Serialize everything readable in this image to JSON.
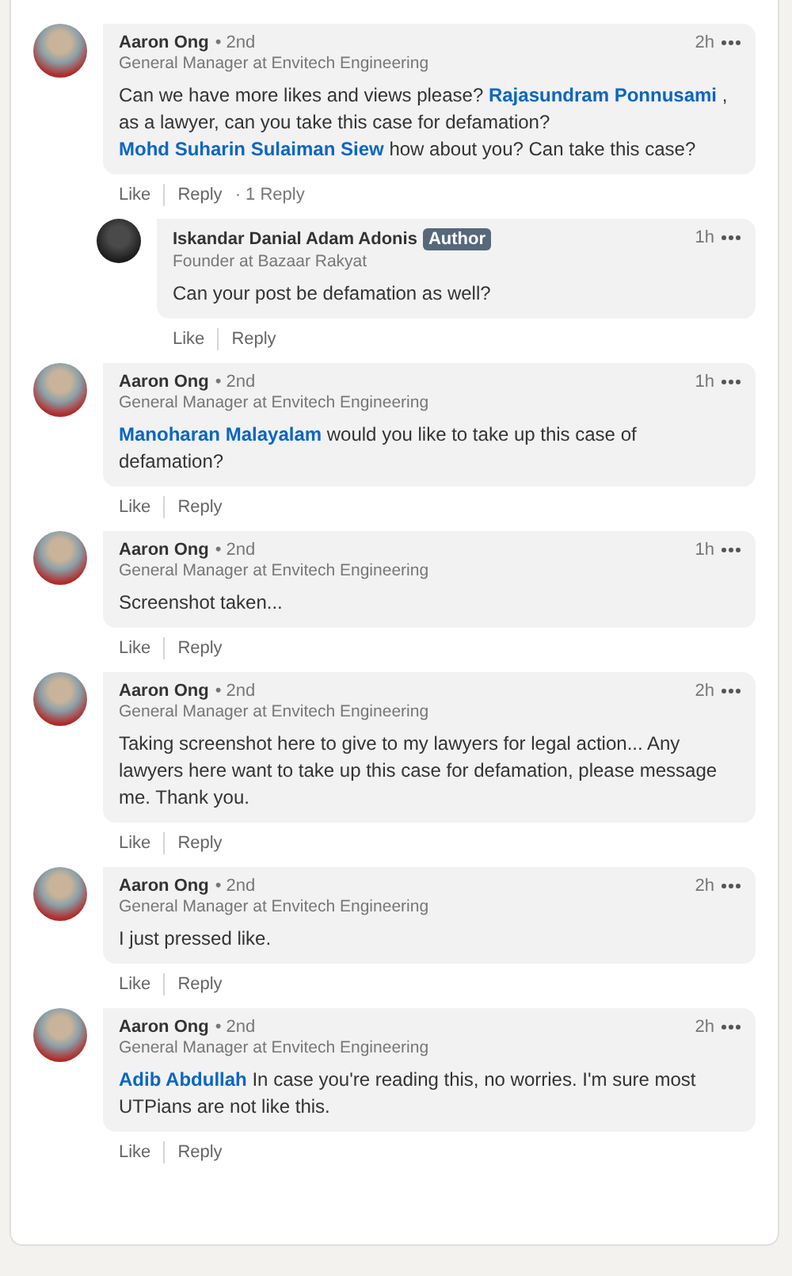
{
  "comments": [
    {
      "name": "Aaron Ong",
      "degree": "• 2nd",
      "headline": "General Manager at Envitech Engineering",
      "time": "2h",
      "body": [
        {
          "kind": "text",
          "text": "Can we have more likes and views please? "
        },
        {
          "kind": "mention",
          "text": "Rajasundram Ponnusami"
        },
        {
          "kind": "text",
          "text": " , as a lawyer, can you take this case for defamation? "
        },
        {
          "kind": "mention",
          "text": "Mohd Suharin Sulaiman Siew"
        },
        {
          "kind": "text",
          "text": " how about you?  Can take this case?"
        }
      ],
      "actions": [
        "Like",
        "Reply"
      ],
      "reply_count": "· 1 Reply",
      "replies": [
        {
          "name": "Iskandar Danial Adam Adonis",
          "badge": "Author",
          "headline": "Founder at Bazaar Rakyat",
          "time": "1h",
          "body": [
            {
              "kind": "text",
              "text": "Can your post be defamation as well?"
            }
          ],
          "actions": [
            "Like",
            "Reply"
          ]
        }
      ]
    },
    {
      "name": "Aaron Ong",
      "degree": "• 2nd",
      "headline": "General Manager at Envitech Engineering",
      "time": "1h",
      "body": [
        {
          "kind": "mention",
          "text": "Manoharan Malayalam"
        },
        {
          "kind": "text",
          "text": " would you like to take up this case of defamation?"
        }
      ],
      "actions": [
        "Like",
        "Reply"
      ]
    },
    {
      "name": "Aaron Ong",
      "degree": "• 2nd",
      "headline": "General Manager at Envitech Engineering",
      "time": "1h",
      "body": [
        {
          "kind": "text",
          "text": "Screenshot taken..."
        }
      ],
      "actions": [
        "Like",
        "Reply"
      ]
    },
    {
      "name": "Aaron Ong",
      "degree": "• 2nd",
      "headline": "General Manager at Envitech Engineering",
      "time": "2h",
      "body": [
        {
          "kind": "text",
          "text": "Taking screenshot here to give to my lawyers for legal action...  Any lawyers here want to take up this case for defamation, please message me.  Thank you."
        }
      ],
      "actions": [
        "Like",
        "Reply"
      ]
    },
    {
      "name": "Aaron Ong",
      "degree": "• 2nd",
      "headline": "General Manager at Envitech Engineering",
      "time": "2h",
      "body": [
        {
          "kind": "text",
          "text": "I just pressed like."
        }
      ],
      "actions": [
        "Like",
        "Reply"
      ]
    },
    {
      "name": "Aaron Ong",
      "degree": "• 2nd",
      "headline": "General Manager at Envitech Engineering",
      "time": "2h",
      "body": [
        {
          "kind": "mention",
          "text": "Adib Abdullah"
        },
        {
          "kind": "text",
          "text": " In case you're reading this, no worries.  I'm sure most UTPians are not like this."
        }
      ],
      "actions": [
        "Like",
        "Reply"
      ]
    }
  ]
}
